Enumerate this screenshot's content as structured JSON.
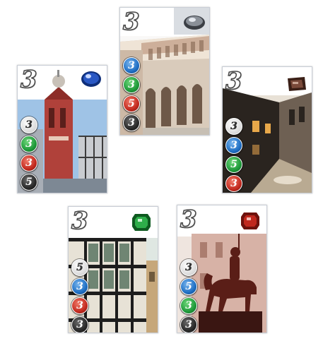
{
  "cards": [
    {
      "id": "card-top",
      "prestige": "3",
      "gem": "diamond-gem",
      "costs": [
        {
          "color": "blue",
          "value": "3"
        },
        {
          "color": "green",
          "value": "3"
        },
        {
          "color": "red",
          "value": "5"
        },
        {
          "color": "black",
          "value": "3"
        }
      ]
    },
    {
      "id": "card-left",
      "prestige": "3",
      "gem": "sapphire-gem",
      "costs": [
        {
          "color": "white",
          "value": "3"
        },
        {
          "color": "green",
          "value": "3"
        },
        {
          "color": "red",
          "value": "3"
        },
        {
          "color": "black",
          "value": "5"
        }
      ]
    },
    {
      "id": "card-right",
      "prestige": "3",
      "gem": "onyx-gem",
      "costs": [
        {
          "color": "white",
          "value": "3"
        },
        {
          "color": "blue",
          "value": "3"
        },
        {
          "color": "green",
          "value": "5"
        },
        {
          "color": "red",
          "value": "3"
        }
      ]
    },
    {
      "id": "card-bottom-left",
      "prestige": "3",
      "gem": "emerald-gem",
      "costs": [
        {
          "color": "white",
          "value": "5"
        },
        {
          "color": "blue",
          "value": "3"
        },
        {
          "color": "red",
          "value": "3"
        },
        {
          "color": "black",
          "value": "3"
        }
      ]
    },
    {
      "id": "card-bottom-right",
      "prestige": "3",
      "gem": "ruby-gem",
      "costs": [
        {
          "color": "white",
          "value": "3"
        },
        {
          "color": "blue",
          "value": "5"
        },
        {
          "color": "green",
          "value": "3"
        },
        {
          "color": "black",
          "value": "3"
        }
      ]
    }
  ]
}
